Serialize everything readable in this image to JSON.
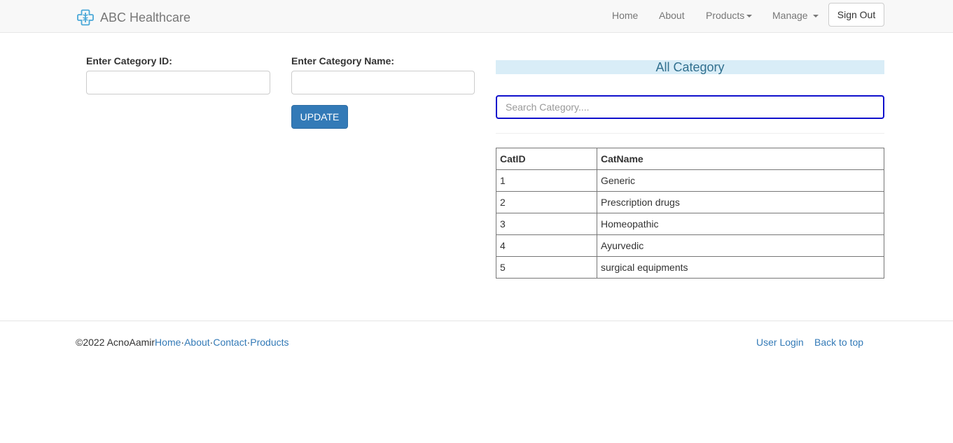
{
  "navbar": {
    "brand": "ABC Healthcare",
    "brand_logo": "medical-cross-icon",
    "links": {
      "home": "Home",
      "about": "About",
      "products": "Products",
      "manage": "Manage"
    },
    "sign_out": "Sign Out"
  },
  "form": {
    "id_label": "Enter Category ID:",
    "id_value": "",
    "name_label": "Enter Category Name:",
    "name_value": "",
    "update_button": "UPDATE"
  },
  "category_panel": {
    "heading": "All Category",
    "search_placeholder": "Search Category....",
    "search_value": "",
    "table": {
      "headers": [
        "CatID",
        "CatName"
      ],
      "rows": [
        [
          "1",
          "Generic"
        ],
        [
          "2",
          "Prescription drugs"
        ],
        [
          "3",
          "Homeopathic"
        ],
        [
          "4",
          "Ayurvedic"
        ],
        [
          "5",
          "surgical equipments"
        ]
      ]
    }
  },
  "footer": {
    "copyright": "©2022 AcnoAamir",
    "links": [
      "Home",
      "About",
      "Contact",
      "Products"
    ],
    "separator": "·",
    "user_login": "User Login",
    "back_to_top": "Back to top"
  },
  "colors": {
    "navbar_bg": "#f8f8f8",
    "primary": "#337ab7",
    "panel_heading_bg": "#d9edf7",
    "panel_heading_text": "#31708f",
    "search_focus_border": "#1111cc",
    "logo": "#4aa8d8"
  }
}
